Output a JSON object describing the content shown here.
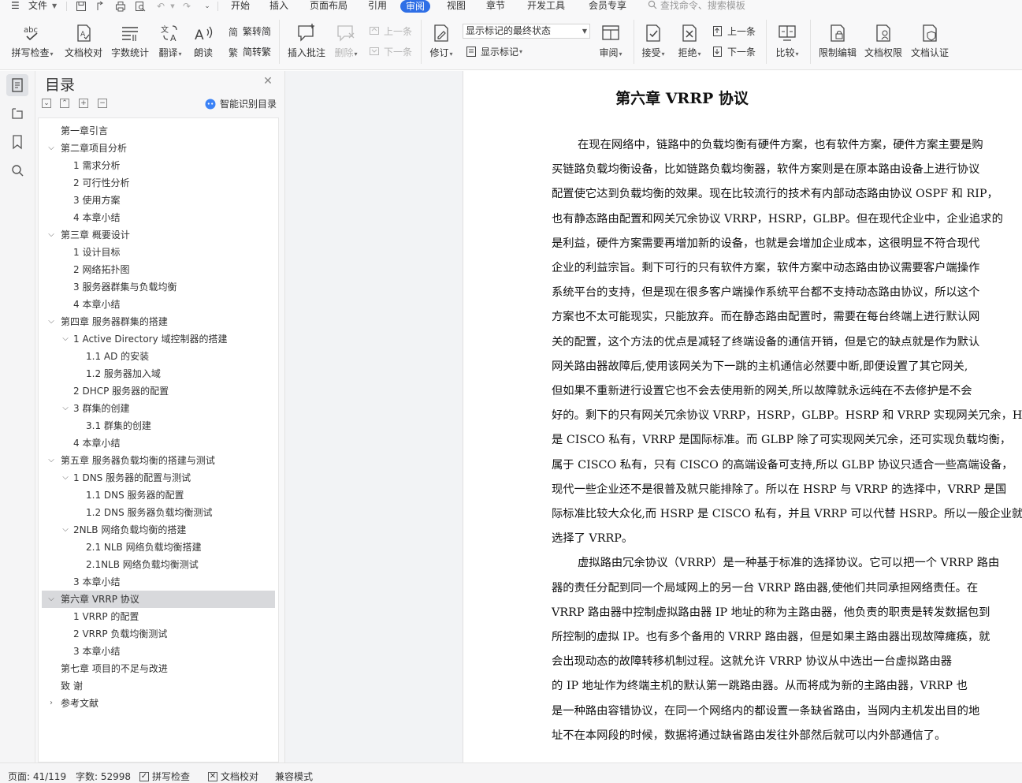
{
  "menubar": {
    "file_label": "文件",
    "tabs": [
      "开始",
      "插入",
      "页面布局",
      "引用",
      "审阅",
      "视图",
      "章节",
      "开发工具",
      "会员专享"
    ],
    "active_tab": "审阅",
    "search_placeholder": "查找命令、搜索模板"
  },
  "ribbon": {
    "spell_check": "拼写检查",
    "doc_proof": "文档校对",
    "word_count": "字数统计",
    "translate": "翻译",
    "read_aloud": "朗读",
    "trad_to_simp": "繁转简",
    "simp_to_trad": "简转繁",
    "insert_comment": "插入批注",
    "delete": "删除",
    "prev_comment": "上一条",
    "next_comment": "下一条",
    "track_changes": "修订",
    "display_mode": "显示标记的最终状态",
    "show_markup": "显示标记",
    "review": "审阅",
    "accept": "接受",
    "reject": "拒绝",
    "prev_change": "上一条",
    "next_change": "下一条",
    "compare": "比较",
    "restrict_editing": "限制编辑",
    "doc_permission": "文档权限",
    "doc_cert": "文档认证"
  },
  "toc": {
    "title": "目录",
    "smart_label": "智能识别目录",
    "items": [
      {
        "text": "第一章引言",
        "level": 0,
        "chev": ""
      },
      {
        "text": "第二章项目分析",
        "level": 0,
        "chev": "v"
      },
      {
        "text": "1  需求分析",
        "level": 1,
        "chev": ""
      },
      {
        "text": "2  可行性分析",
        "level": 1,
        "chev": ""
      },
      {
        "text": "3  使用方案",
        "level": 1,
        "chev": ""
      },
      {
        "text": "4 本章小结",
        "level": 1,
        "chev": ""
      },
      {
        "text": "第三章  概要设计",
        "level": 0,
        "chev": "v"
      },
      {
        "text": "1 设计目标",
        "level": 1,
        "chev": ""
      },
      {
        "text": "2 网络拓扑图",
        "level": 1,
        "chev": ""
      },
      {
        "text": "3 服务器群集与负载均衡",
        "level": 1,
        "chev": ""
      },
      {
        "text": "4 本章小结",
        "level": 1,
        "chev": ""
      },
      {
        "text": "第四章  服务器群集的搭建",
        "level": 0,
        "chev": "v"
      },
      {
        "text": "1    Active Directory 域控制器的搭建",
        "level": 1,
        "chev": "v"
      },
      {
        "text": "1.1    AD 的安装",
        "level": 2,
        "chev": ""
      },
      {
        "text": "1.2  服务器加入域",
        "level": 2,
        "chev": ""
      },
      {
        "text": "2    DHCP 服务器的配置",
        "level": 1,
        "chev": ""
      },
      {
        "text": "3    群集的创建",
        "level": 1,
        "chev": "v"
      },
      {
        "text": "3.1  群集的创建",
        "level": 2,
        "chev": ""
      },
      {
        "text": "4    本章小结",
        "level": 1,
        "chev": ""
      },
      {
        "text": "第五章  服务器负载均衡的搭建与测试",
        "level": 0,
        "chev": "v"
      },
      {
        "text": "1    DNS 服务器的配置与测试",
        "level": 1,
        "chev": "v"
      },
      {
        "text": "1.1    DNS 服务器的配置",
        "level": 2,
        "chev": ""
      },
      {
        "text": "1.2 DNS 服务器负载均衡测试",
        "level": 2,
        "chev": ""
      },
      {
        "text": "2NLB 网络负载均衡的搭建",
        "level": 1,
        "chev": "v"
      },
      {
        "text": "2.1    NLB 网络负载均衡搭建",
        "level": 2,
        "chev": ""
      },
      {
        "text": "2.1NLB 网络负载均衡测试",
        "level": 2,
        "chev": ""
      },
      {
        "text": "3    本章小结",
        "level": 1,
        "chev": ""
      },
      {
        "text": "第六章  VRRP 协议",
        "level": 0,
        "chev": "v",
        "selected": true
      },
      {
        "text": "1 VRRP 的配置",
        "level": 1,
        "chev": ""
      },
      {
        "text": "2 VRRP 负载均衡测试",
        "level": 1,
        "chev": ""
      },
      {
        "text": "3  本章小结",
        "level": 1,
        "chev": ""
      },
      {
        "text": "第七章  项目的不足与改进",
        "level": 0,
        "chev": ""
      },
      {
        "text": "致    谢",
        "level": 0,
        "chev": ""
      },
      {
        "text": "参考文献",
        "level": 0,
        "chev": ">"
      }
    ]
  },
  "document": {
    "heading": "第六章  VRRP 协议",
    "lines": [
      {
        "text": "在现在网络中，链路中的负载均衡有硬件方案，也有软件方案，硬件方案主要是购",
        "indent": true
      },
      {
        "text": "买链路负载均衡设备，比如链路负载均衡器，软件方案则是在原本路由设备上进行协议",
        "indent": false
      },
      {
        "text": "配置使它达到负载均衡的效果。现在比较流行的技术有内部动态路由协议 OSPF 和 RIP，",
        "indent": false
      },
      {
        "text": "也有静态路由配置和网关冗余协议 VRRP，HSRP，GLBP。但在现代企业中，企业追求的",
        "indent": false
      },
      {
        "text": "是利益，硬件方案需要再增加新的设备，也就是会增加企业成本，这很明显不符合现代",
        "indent": false
      },
      {
        "text": "企业的利益宗旨。剩下可行的只有软件方案，软件方案中动态路由协议需要客户端操作",
        "indent": false
      },
      {
        "text": "系统平台的支持，但是现在很多客户端操作系统平台都不支持动态路由协议，所以这个",
        "indent": false
      },
      {
        "text": "方案也不太可能现实，只能放弃。而在静态路由配置时，需要在每台终端上进行默认网",
        "indent": false
      },
      {
        "text": "关的配置，这个方法的优点是减轻了终端设备的通信开销，但是它的缺点就是作为默认",
        "indent": false
      },
      {
        "text": "网关路由器故障后,使用该网关为下一跳的主机通信必然要中断,即便设置了其它网关,",
        "indent": false
      },
      {
        "text": "但如果不重新进行设置它也不会去使用新的网关,所以故障就永远纯在不去修护是不会",
        "indent": false
      },
      {
        "text": "好的。剩下的只有网关冗余协议 VRRP，HSRP，GLBP。HSRP 和 VRRP 实现网关冗余，HSRP",
        "indent": false
      },
      {
        "text": "是 CISCO 私有，VRRP 是国际标准。而 GLBP 除了可实现网关冗余，还可实现负载均衡，",
        "indent": false
      },
      {
        "text": "属于 CISCO 私有，只有 CISCO 的高端设备可支持,所以 GLBP 协议只适合一些高端设备，",
        "indent": false
      },
      {
        "text": "现代一些企业还不是很普及就只能排除了。所以在 HSRP 与 VRRP 的选择中，VRRP 是国",
        "indent": false
      },
      {
        "text": "际标准比较大众化,而 HSRP 是 CISCO 私有，并且 VRRP 可以代替 HSRP。所以一般企业就",
        "indent": false
      },
      {
        "text": "选择了 VRRP。",
        "indent": false
      },
      {
        "text": "虚拟路由冗余协议（VRRP）是一种基于标准的选择协议。它可以把一个 VRRP 路由",
        "indent": true
      },
      {
        "text": "器的责任分配到同一个局域网上的另一台 VRRP 路由器,使他们共同承担网络责任。在",
        "indent": false
      },
      {
        "text": "VRRP 路由器中控制虚拟路由器 IP 地址的称为主路由器，他负责的职责是转发数据包到",
        "indent": false
      },
      {
        "text": "所控制的虚拟 IP。也有多个备用的 VRRP 路由器，但是如果主路由器出现故障瘫痪，就",
        "indent": false
      },
      {
        "text": "会出现动态的故障转移机制过程。这就允许 VRRP 协议从中选出一台虚拟路由器",
        "indent": false
      },
      {
        "text": "的   IP   地址作为终端主机的默认第一跳路由器。从而将成为新的主路由器，VRRP 也",
        "indent": false
      },
      {
        "text": "是一种路由容错协议，在同一个网络内的都设置一条缺省路由，当网内主机发出目的地",
        "indent": false
      },
      {
        "text": "址不在本网段的时候，数据将通过缺省路由发往外部然后就可以内外部通信了。",
        "indent": false
      }
    ]
  },
  "statusbar": {
    "page": "页面: 41/119",
    "word_count": "字数: 52998",
    "spell_check": "拼写检查",
    "doc_proof": "文档校对",
    "compat_mode": "兼容模式"
  },
  "colors": {
    "accent": "#2f6fe6",
    "selected_row": "#d8d9dc"
  }
}
